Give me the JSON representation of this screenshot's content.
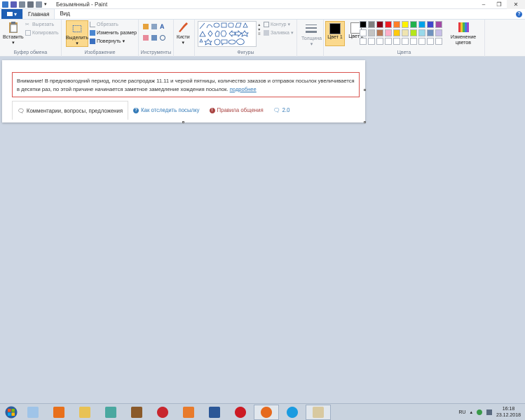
{
  "window": {
    "title": "Безымянный - Paint"
  },
  "tabs": [
    {
      "label": "Главная",
      "active": true
    },
    {
      "label": "Вид",
      "active": false
    }
  ],
  "ribbon": {
    "clipboard": {
      "paste": "Вставить",
      "cut": "Вырезать",
      "copy": "Копировать",
      "group": "Буфер обмена"
    },
    "image": {
      "select": "Выделить",
      "crop": "Обрезать",
      "resize": "Изменить размер",
      "rotate": "Повернуть",
      "group": "Изображение"
    },
    "tools": {
      "group": "Инструменты"
    },
    "brushes": {
      "label": "Кисти"
    },
    "shapes": {
      "outline": "Контур",
      "fill": "Заливка",
      "group": "Фигуры"
    },
    "size": {
      "label": "Толщина"
    },
    "colors": {
      "color1": "Цвет 1",
      "color2": "Цвет 2",
      "edit": "Изменение цветов",
      "group": "Цвета"
    }
  },
  "palette": [
    "#000000",
    "#7f7f7f",
    "#880015",
    "#ed1c24",
    "#ff7f27",
    "#fff200",
    "#22b14c",
    "#00a2e8",
    "#3f48cc",
    "#a349a4",
    "#ffffff",
    "#c3c3c3",
    "#b97a57",
    "#ffaec9",
    "#ffc90e",
    "#efe4b0",
    "#b5e61d",
    "#99d9ea",
    "#7092be",
    "#c8bfe7",
    "#ffffff",
    "#ffffff",
    "#ffffff",
    "#ffffff",
    "#ffffff",
    "#ffffff",
    "#ffffff",
    "#ffffff",
    "#ffffff",
    "#ffffff"
  ],
  "canvas": {
    "notice": "Внимание! В предновогодний период, после распродаж 11.11 и черной пятницы, количество заказов и отправок посылок увеличивается в десятки раз, по этой причине начинается заметное замедление хождения посылок.",
    "more_link": "подробнее",
    "tabs": [
      {
        "label": "Комментарии, вопросы, предложения"
      },
      {
        "label": "Как отследить посылку"
      },
      {
        "label": "Правила общения"
      },
      {
        "label": "2.0"
      }
    ]
  },
  "taskbar": {
    "lang": "RU",
    "time": "16:18",
    "date": "23.12.2018"
  },
  "colors": {
    "accent": "#1e5fb4",
    "selected": "#fbd98d",
    "notice_border": "#d9534f",
    "link": "#337ab7"
  }
}
